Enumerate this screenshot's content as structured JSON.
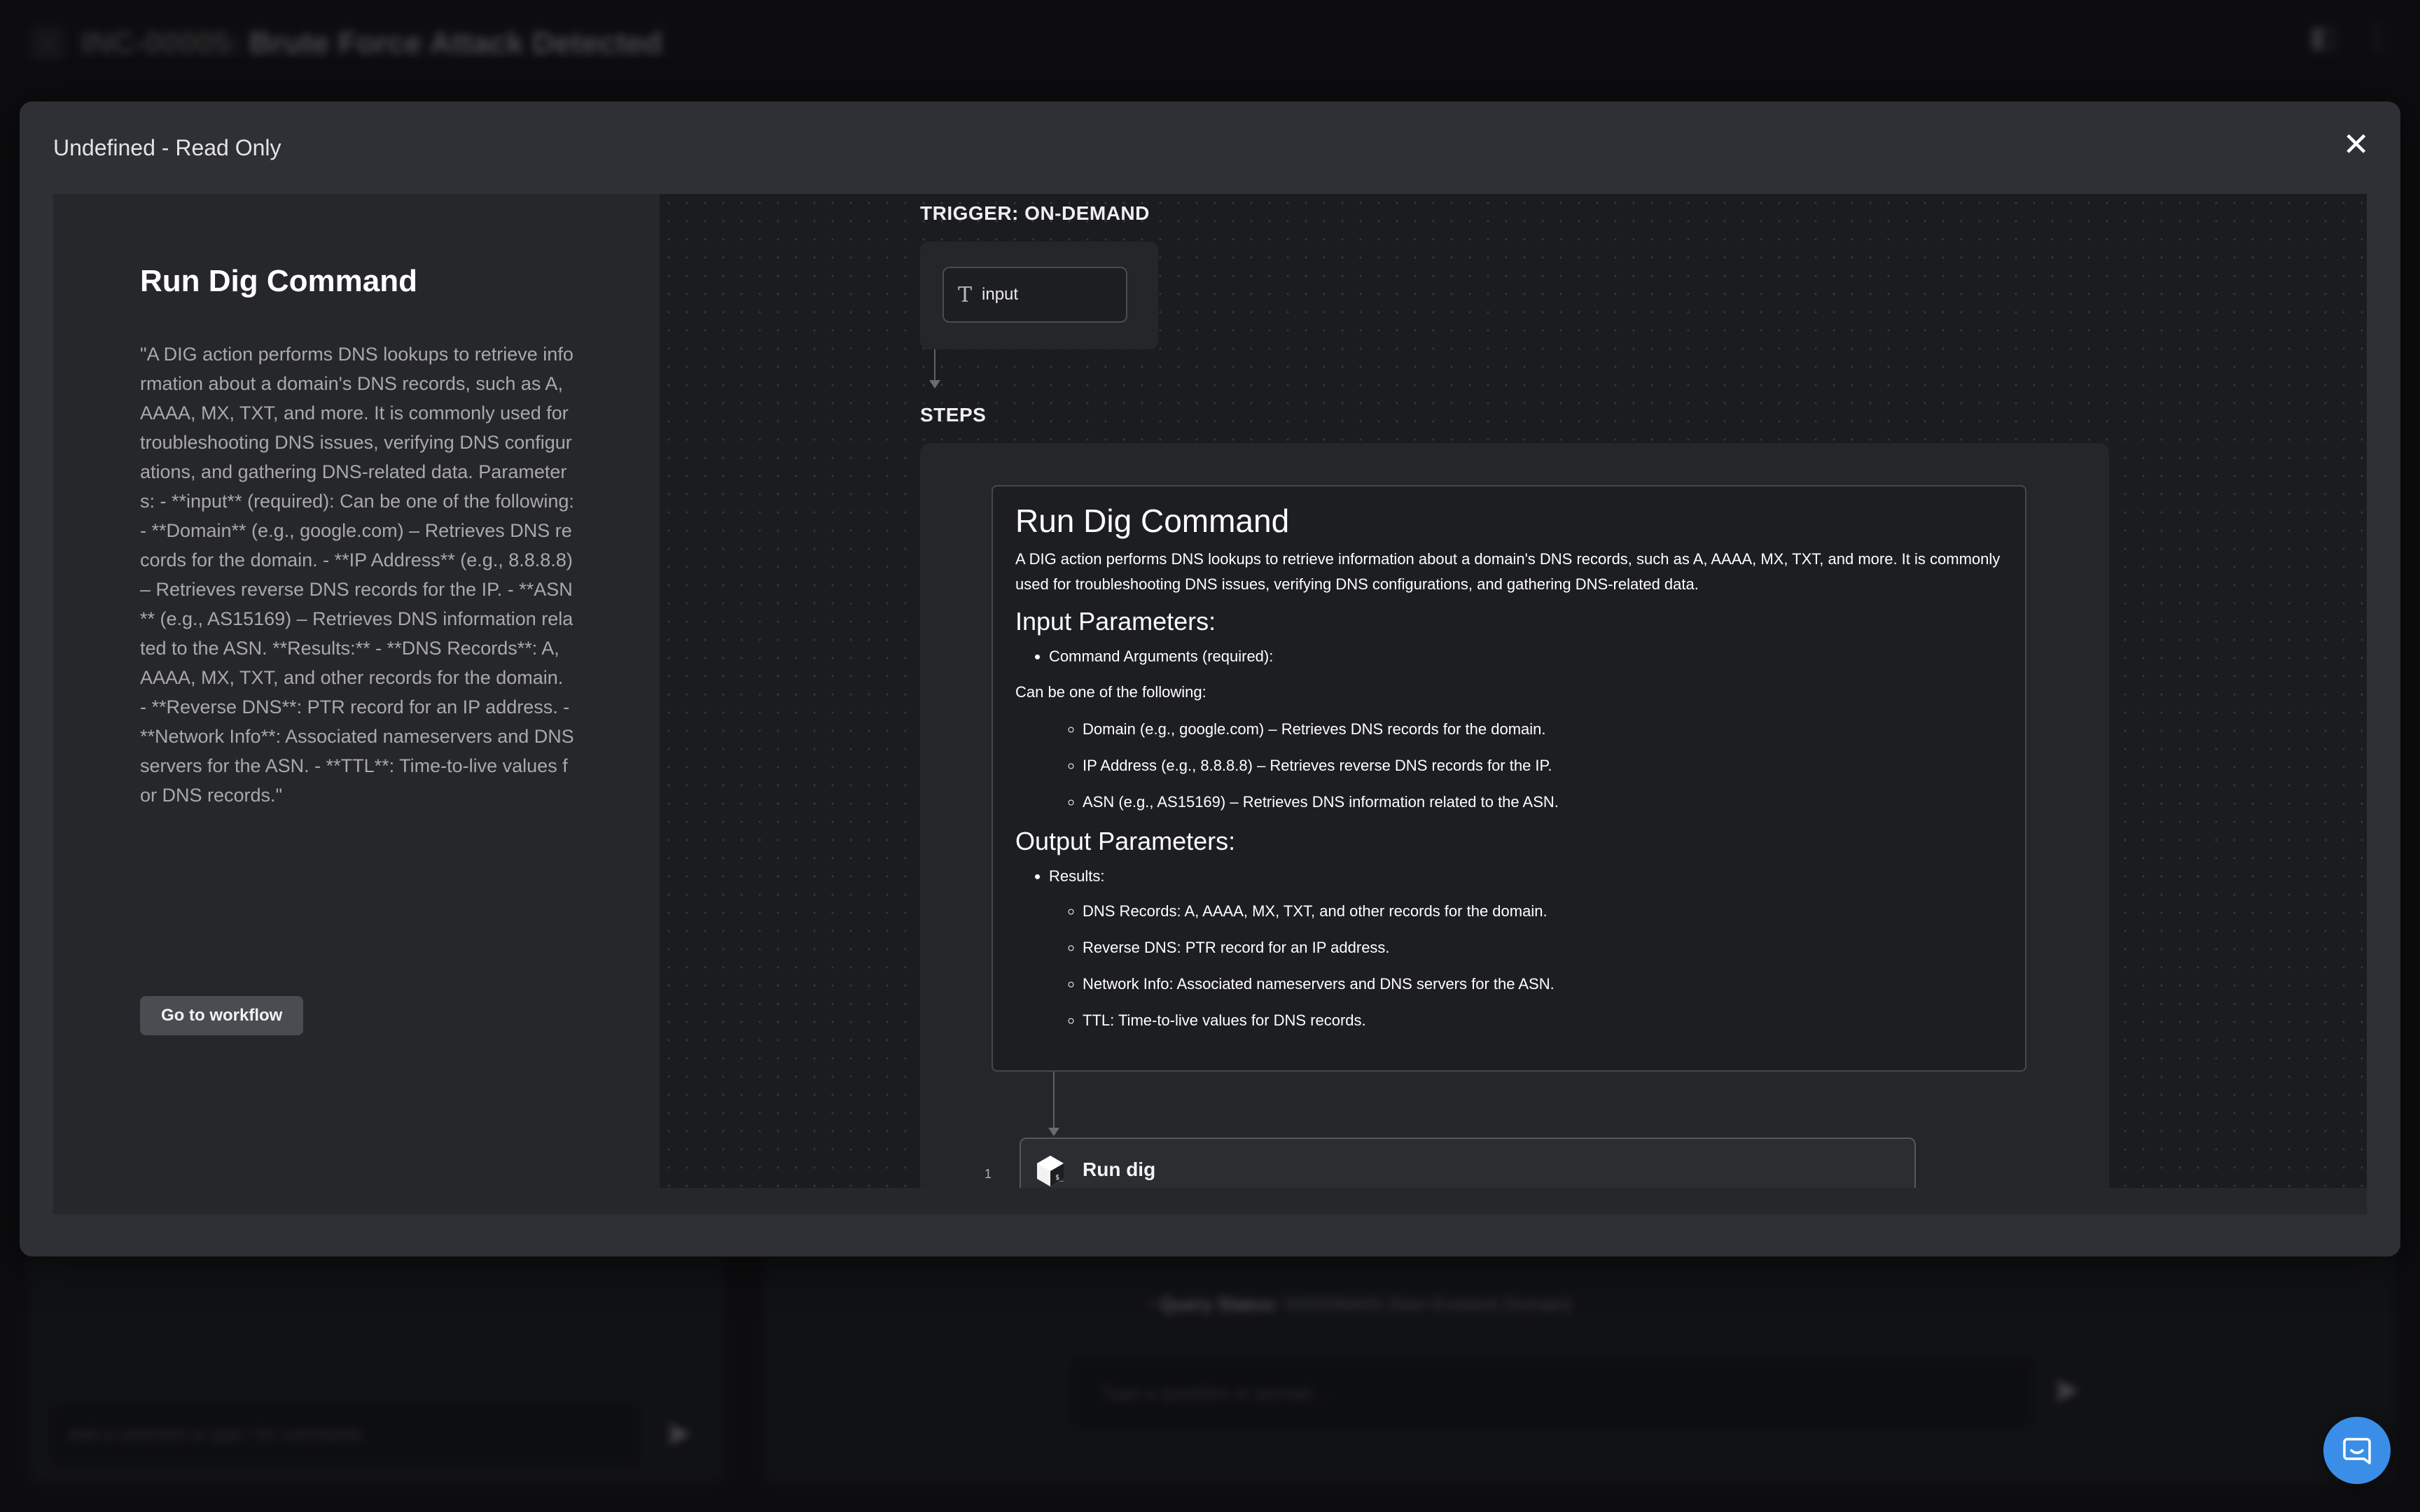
{
  "background": {
    "incident_id": "INC-00005:",
    "incident_title": "Brute Force Attack Detected",
    "query_status_label": "Query Status:",
    "query_status_value": "NXDOMAIN (Non-Existent Domain)",
    "comment_placeholder": "Add a comment or type / for commands",
    "prompt_placeholder": "Type a question or prompt..."
  },
  "modal": {
    "title": "Undefined - Read Only",
    "close_glyph": "✕"
  },
  "info": {
    "title": "Run Dig Command",
    "description": "\"A DIG action performs DNS lookups to retrieve information about a domain's DNS records, such as A, AAAA, MX, TXT, and more. It is commonly used for troubleshooting DNS issues, verifying DNS configurations, and gathering DNS-related data. Parameters: - **input** (required): Can be one of the following: - **Domain** (e.g., google.com) – Retrieves DNS records for the domain. - **IP Address** (e.g., 8.8.8.8) – Retrieves reverse DNS records for the IP. - **ASN** (e.g., AS15169) – Retrieves DNS information related to the ASN. **Results:** - **DNS Records**: A, AAAA, MX, TXT, and other records for the domain. - **Reverse DNS**: PTR record for an IP address. - **Network Info**: Associated nameservers and DNS servers for the ASN. - **TTL**: Time-to-live values for DNS records.\"",
    "button_label": "Go to workflow"
  },
  "canvas": {
    "trigger_label": "TRIGGER: ON-DEMAND",
    "input_node_icon": "T",
    "input_node_label": "input",
    "steps_label": "STEPS",
    "doc": {
      "title": "Run Dig Command",
      "intro": "A DIG action performs DNS lookups to retrieve information about a domain's DNS records, such as A, AAAA, MX, TXT, and more. It is commonly used for troubleshooting DNS issues, verifying DNS configurations, and gathering DNS-related data.",
      "input_heading": "Input Parameters:",
      "input_bullet": "Command Arguments (required):",
      "can_be": "Can be one of the following:",
      "input_options": [
        "Domain (e.g., google.com) – Retrieves DNS records for the domain.",
        "IP Address (e.g., 8.8.8.8) – Retrieves reverse DNS records for the IP.",
        "ASN (e.g., AS15169) – Retrieves DNS information related to the ASN."
      ],
      "output_heading": "Output Parameters:",
      "output_bullet": "Results:",
      "output_items": [
        "DNS Records: A, AAAA, MX, TXT, and other records for the domain.",
        "Reverse DNS: PTR record for an IP address.",
        "Network Info: Associated nameservers and DNS servers for the ASN.",
        "TTL: Time-to-live values for DNS records."
      ]
    },
    "step": {
      "number": "1",
      "icon": "hexagon-shell-icon",
      "label": "Run dig"
    }
  },
  "chat_fab": {
    "icon": "chat-bubble-icon"
  }
}
